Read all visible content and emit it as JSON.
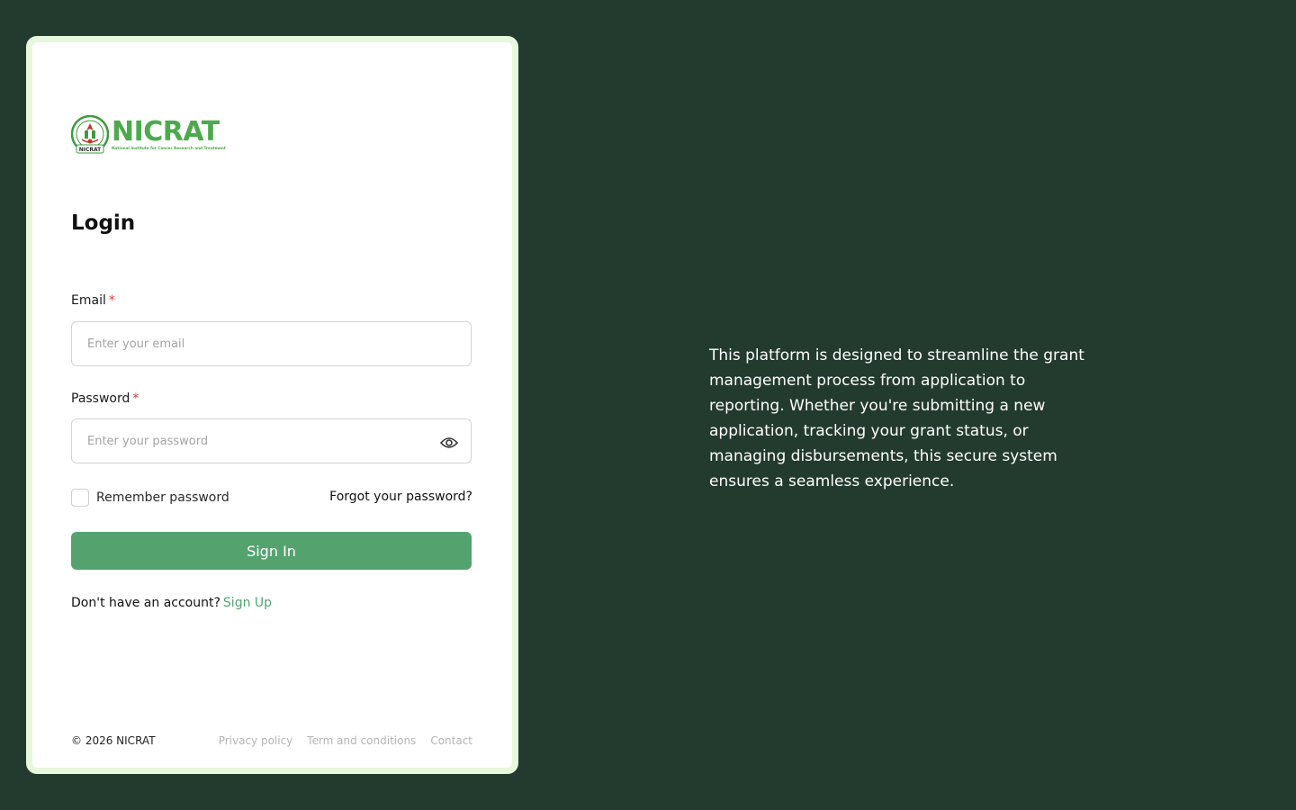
{
  "brand": {
    "name": "NICRAT",
    "subtitle": "National Institute for Cancer Research and Treatment",
    "seal_text": "NICRAT",
    "color": "#4caa4c"
  },
  "login": {
    "title": "Login",
    "email_label": "Email",
    "email_required": "*",
    "email_placeholder": "Enter your email",
    "email_value": "",
    "password_label": "Password",
    "password_required": "*",
    "password_placeholder": "Enter your password",
    "password_value": "",
    "remember_label": "Remember password",
    "forgot_label": "Forgot your password?",
    "signin_label": "Sign In",
    "signup_prompt": "Don't have an account?",
    "signup_link": "Sign Up"
  },
  "footer": {
    "copyright": "© 2026 NICRAT",
    "links": [
      "Privacy policy",
      "Term and conditions",
      "Contact"
    ]
  },
  "side": {
    "description": "This platform is designed to streamline the grant management process from application to reporting. Whether you're submitting a new application, tracking your grant status, or managing disbursements, this secure system ensures a seamless experience."
  },
  "icons": {
    "password_toggle": "eye-icon",
    "logo": "nicrat-seal-icon"
  },
  "colors": {
    "background": "#233a2e",
    "card_border": "#e6f8dc",
    "primary": "#54a36f",
    "required": "#e53935"
  }
}
